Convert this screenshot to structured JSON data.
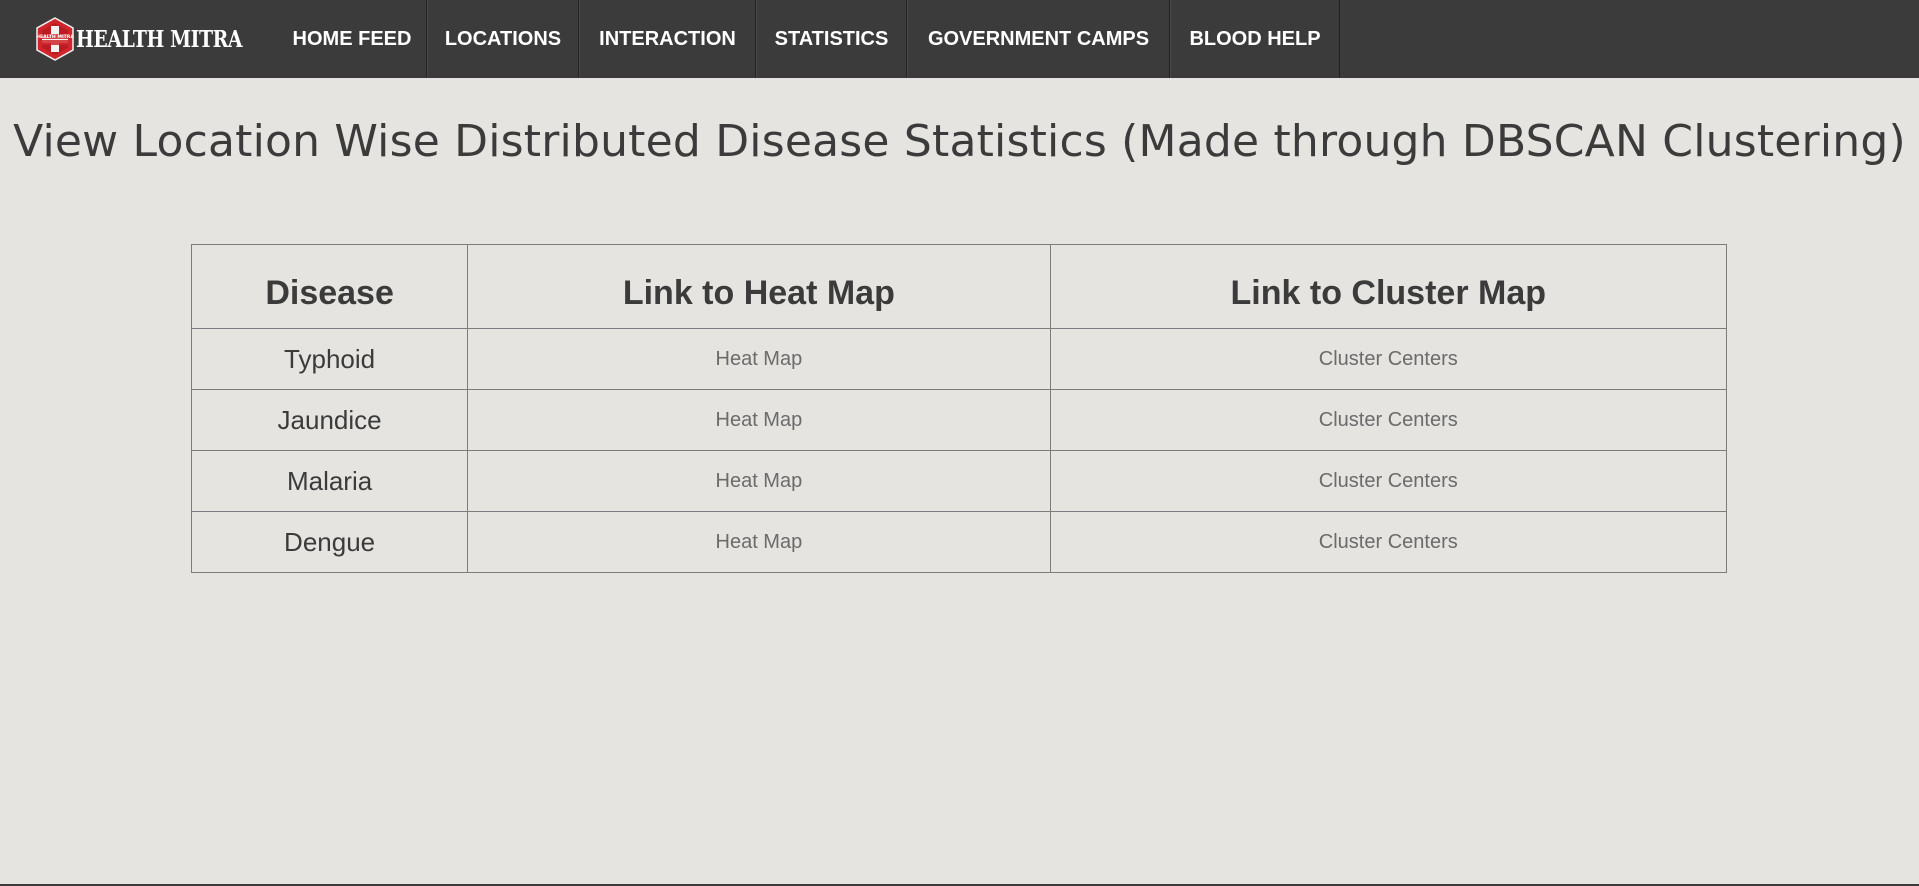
{
  "brand": {
    "name": "HEALTH MITRA",
    "emblem_text": "HEALTH MITRA",
    "emblem_color": "#d0262b"
  },
  "nav": {
    "items": [
      {
        "label": "HOME FEED"
      },
      {
        "label": "LOCATIONS"
      },
      {
        "label": "INTERACTION"
      },
      {
        "label": "STATISTICS"
      },
      {
        "label": "GOVERNMENT CAMPS"
      },
      {
        "label": "BLOOD HELP"
      }
    ]
  },
  "page": {
    "title": "View Location Wise Distributed Disease Statistics (Made through DBSCAN Clustering)"
  },
  "table": {
    "headers": [
      "Disease",
      "Link to Heat Map",
      "Link to Cluster Map"
    ],
    "rows": [
      {
        "disease": "Typhoid",
        "heat_map": "Heat Map",
        "cluster_map": "Cluster Centers"
      },
      {
        "disease": "Jaundice",
        "heat_map": "Heat Map",
        "cluster_map": "Cluster Centers"
      },
      {
        "disease": "Malaria",
        "heat_map": "Heat Map",
        "cluster_map": "Cluster Centers"
      },
      {
        "disease": "Dengue",
        "heat_map": "Heat Map",
        "cluster_map": "Cluster Centers"
      }
    ]
  },
  "colors": {
    "navbar": "#3b3b3b",
    "background": "#e5e4e0",
    "text": "#3b3b3b",
    "link": "#6b6b6b"
  }
}
